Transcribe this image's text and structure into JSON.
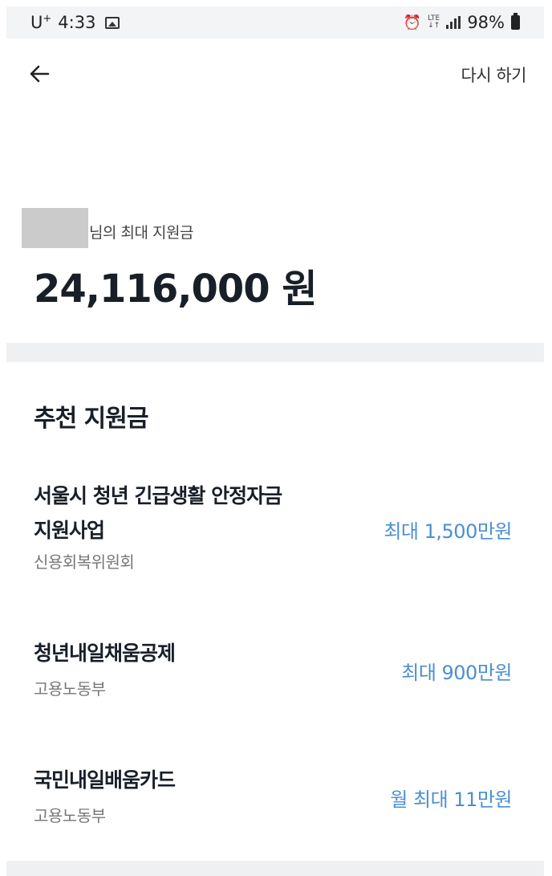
{
  "status_bar": {
    "carrier": "U",
    "carrier_sup": "+",
    "time": "4:33",
    "network": "LTE",
    "battery": "98%"
  },
  "nav": {
    "retry_label": "다시 하기"
  },
  "summary": {
    "subtitle": "님의 최대 지원금",
    "total_amount": "24,116,000 원"
  },
  "section": {
    "title": "추천 지원금"
  },
  "grants": [
    {
      "name_line1": "서울시 청년 긴급생활 안정자금",
      "name_line2": "지원사업",
      "org": "신용회복위원회",
      "amount": "최대 1,500만원"
    },
    {
      "name": "청년내일채움공제",
      "org": "고용노동부",
      "amount": "최대 900만원"
    },
    {
      "name": "국민내일배움카드",
      "org": "고용노동부",
      "amount": "월 최대 11만원"
    }
  ],
  "colors": {
    "accent": "#4a8fd3",
    "divider": "#eef0f2"
  }
}
